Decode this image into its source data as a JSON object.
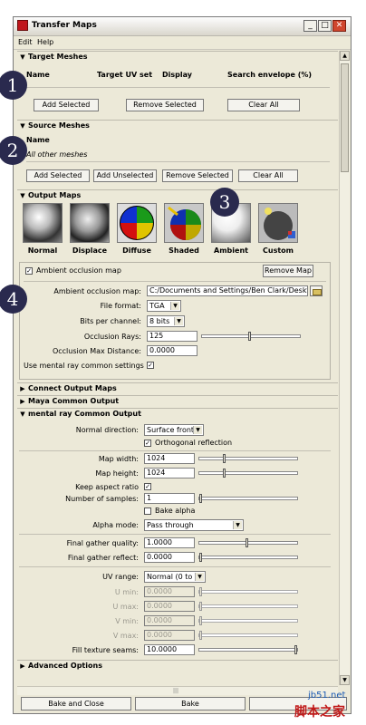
{
  "window": {
    "title": "Transfer Maps",
    "minimize": "_",
    "maximize": "□",
    "close": "✕"
  },
  "menu": {
    "edit": "Edit",
    "help": "Help"
  },
  "target_meshes": {
    "header": "Target Meshes",
    "col_name": "Name",
    "col_uvset": "Target UV set",
    "col_display": "Display",
    "col_envelope": "Search envelope (%)",
    "add": "Add Selected",
    "remove": "Remove Selected",
    "clear": "Clear All"
  },
  "source_meshes": {
    "header": "Source Meshes",
    "col_name": "Name",
    "row": "All other meshes",
    "add": "Add Selected",
    "add_unsel": "Add Unselected",
    "remove": "Remove Selected",
    "clear": "Clear All"
  },
  "output_maps": {
    "header": "Output Maps",
    "thumbs": [
      "Normal",
      "Displace",
      "Diffuse",
      "Shaded",
      "Ambient",
      "Custom"
    ],
    "ao_title": "Ambient occlusion map",
    "remove_map": "Remove Map",
    "ao_map_label": "Ambient occlusion map:",
    "ao_map_value": "C:/Documents and Settings/Ben Clark/Desktop/st",
    "file_format_label": "File format:",
    "file_format": "TGA",
    "bits_label": "Bits per channel:",
    "bits": "8 bits",
    "rays_label": "Occlusion Rays:",
    "rays": "125",
    "maxdist_label": "Occlusion Max Distance:",
    "maxdist": "0.0000",
    "use_mr_label": "Use mental ray common settings"
  },
  "collapsed": {
    "connect": "Connect Output Maps",
    "maya_common": "Maya Common Output"
  },
  "mr_common": {
    "header": "mental ray Common Output",
    "normal_dir_label": "Normal direction:",
    "normal_dir": "Surface front",
    "orthogonal": "Orthogonal reflection",
    "map_width_label": "Map width:",
    "map_width": "1024",
    "map_height_label": "Map height:",
    "map_height": "1024",
    "keep_aspect": "Keep aspect ratio",
    "samples_label": "Number of samples:",
    "samples": "1",
    "bake_alpha": "Bake alpha",
    "alpha_mode_label": "Alpha mode:",
    "alpha_mode": "Pass through",
    "fg_quality_label": "Final gather quality:",
    "fg_quality": "1.0000",
    "fg_reflect_label": "Final gather reflect:",
    "fg_reflect": "0.0000",
    "uv_range_label": "UV range:",
    "uv_range": "Normal (0 to 1)",
    "umin_label": "U min:",
    "umin": "0.0000",
    "umax_label": "U max:",
    "umax": "0.0000",
    "vmin_label": "V min:",
    "vmin": "0.0000",
    "vmax_label": "V max:",
    "vmax": "0.0000",
    "fill_label": "Fill texture seams:",
    "fill": "10.0000"
  },
  "advanced": "Advanced Options",
  "bottom": {
    "bake_close": "Bake and Close",
    "bake": "Bake"
  },
  "markers": [
    "1",
    "2",
    "3",
    "4"
  ],
  "watermark": {
    "site": "jb51.net",
    "brand": "脚本之家"
  },
  "levels": {
    "rays_slider": 0.5,
    "fg_quality_slider": 0.5,
    "fill_slider": 1.0
  },
  "colors": {
    "window_bg": "#ece9d8",
    "marker": "#2a2a4e",
    "close_button": "#d0462e"
  }
}
